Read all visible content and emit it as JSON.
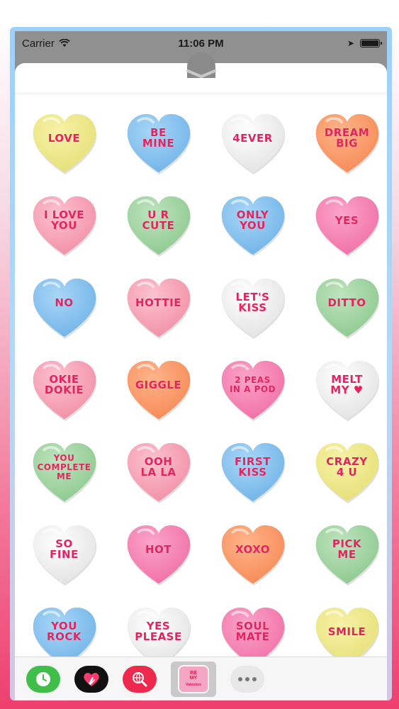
{
  "status": {
    "carrier": "Carrier",
    "time": "11:06 PM"
  },
  "stickers": [
    {
      "text": "LOVE",
      "color": "yellow"
    },
    {
      "text": "BE\nMINE",
      "color": "blue"
    },
    {
      "text": "4EVER",
      "color": "white"
    },
    {
      "text": "DREAM\nBIG",
      "color": "orange"
    },
    {
      "text": "I LOVE\nYOU",
      "color": "pink"
    },
    {
      "text": "U R\nCUTE",
      "color": "green"
    },
    {
      "text": "ONLY\nYOU",
      "color": "blue"
    },
    {
      "text": "YES",
      "color": "hotpink"
    },
    {
      "text": "NO",
      "color": "blue"
    },
    {
      "text": "HOTTIE",
      "color": "pink"
    },
    {
      "text": "LET'S\nKISS",
      "color": "white"
    },
    {
      "text": "DITTO",
      "color": "green"
    },
    {
      "text": "OKIE\nDOKIE",
      "color": "pink"
    },
    {
      "text": "GIGGLE",
      "color": "orange"
    },
    {
      "text": "2 PEAS\nIN A POD",
      "color": "hotpink"
    },
    {
      "text": "MELT\nMY ♥",
      "color": "white"
    },
    {
      "text": "YOU\nCOMPLETE\nME",
      "color": "green"
    },
    {
      "text": "OOH\nLA LA",
      "color": "pink"
    },
    {
      "text": "FIRST\nKISS",
      "color": "blue"
    },
    {
      "text": "CRAZY\n4 U",
      "color": "yellow"
    },
    {
      "text": "SO\nFINE",
      "color": "white"
    },
    {
      "text": "HOT",
      "color": "hotpink"
    },
    {
      "text": "XOXO",
      "color": "orange"
    },
    {
      "text": "PICK\nME",
      "color": "green"
    },
    {
      "text": "YOU\nROCK",
      "color": "blue"
    },
    {
      "text": "YES\nPLEASE",
      "color": "white"
    },
    {
      "text": "SOUL\nMATE",
      "color": "hotpink"
    },
    {
      "text": "SMILE",
      "color": "yellow"
    }
  ],
  "palette": {
    "yellow": [
      "#f7f2a6",
      "#e6df78"
    ],
    "blue": [
      "#a9d6f7",
      "#6fb3e8"
    ],
    "white": [
      "#ffffff",
      "#e2e2e2"
    ],
    "orange": [
      "#ffb38a",
      "#f68a55"
    ],
    "pink": [
      "#fcc2cf",
      "#f28ea5"
    ],
    "green": [
      "#bfe3be",
      "#8cc98e"
    ],
    "hotpink": [
      "#fba4c8",
      "#f06ea5"
    ]
  },
  "tray": {
    "app_label_top": "BE\nMY",
    "app_label_bottom": "Valentine"
  }
}
